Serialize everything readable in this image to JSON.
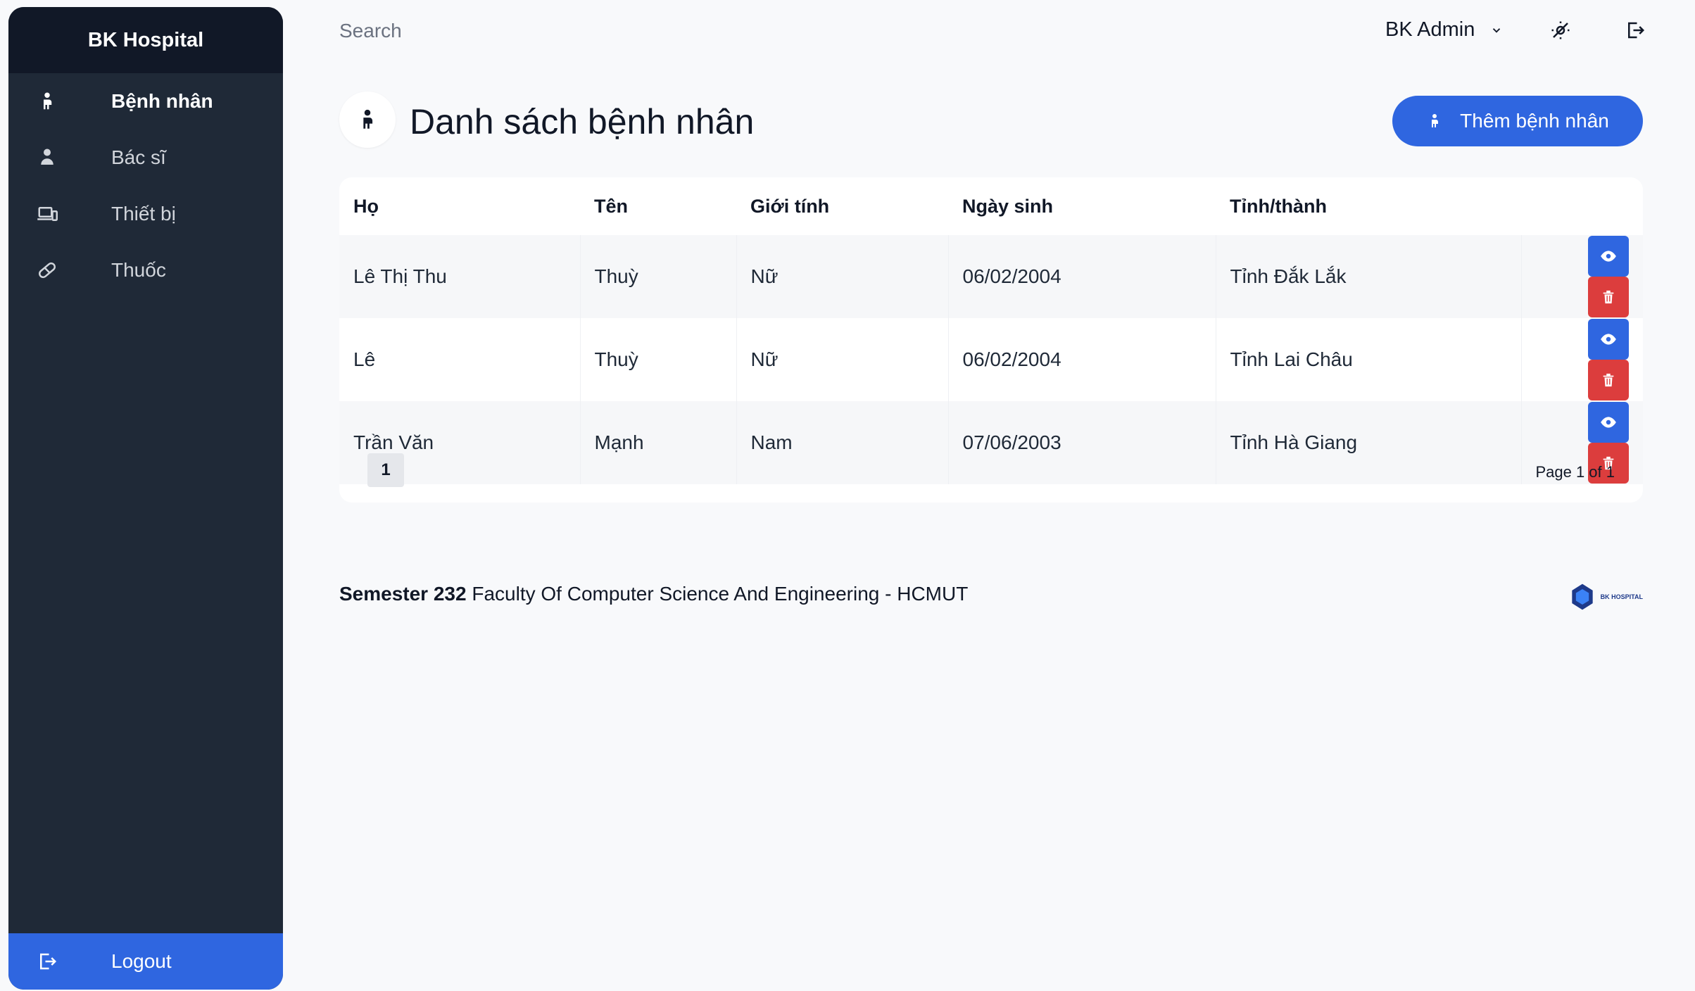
{
  "sidebar": {
    "brand": "BK Hospital",
    "items": [
      {
        "label": "Bệnh nhân",
        "icon": "patient-icon",
        "active": true
      },
      {
        "label": "Bác sĩ",
        "icon": "doctor-icon",
        "active": false
      },
      {
        "label": "Thiết bị",
        "icon": "devices-icon",
        "active": false
      },
      {
        "label": "Thuốc",
        "icon": "pill-icon",
        "active": false
      }
    ],
    "logout_label": "Logout"
  },
  "topbar": {
    "search_placeholder": "Search",
    "user_name": "BK Admin"
  },
  "page": {
    "title": "Danh sách bệnh nhân",
    "add_button_label": "Thêm bệnh nhân"
  },
  "table": {
    "headers": [
      "Họ",
      "Tên",
      "Giới tính",
      "Ngày sinh",
      "Tỉnh/thành"
    ],
    "rows": [
      [
        "Lê Thị Thu",
        "Thuỳ",
        "Nữ",
        "06/02/2004",
        "Tỉnh Đắk Lắk"
      ],
      [
        "Lê",
        "Thuỳ",
        "Nữ",
        "06/02/2004",
        "Tỉnh Lai Châu"
      ],
      [
        "Trần Văn",
        "Mạnh",
        "Nam",
        "07/06/2003",
        "Tỉnh Hà Giang"
      ]
    ]
  },
  "pagination": {
    "current_page": "1",
    "info": "Page 1 of 1"
  },
  "footer": {
    "semester": "Semester 232",
    "faculty": "Faculty Of Computer Science And Engineering - HCMUT",
    "logo_text": "BK HOSPITAL"
  },
  "colors": {
    "primary": "#2f66e0",
    "danger": "#dc3d3d",
    "sidebar": "#1f2937",
    "sidebar_header": "#111827",
    "background": "#f8f9fb"
  }
}
